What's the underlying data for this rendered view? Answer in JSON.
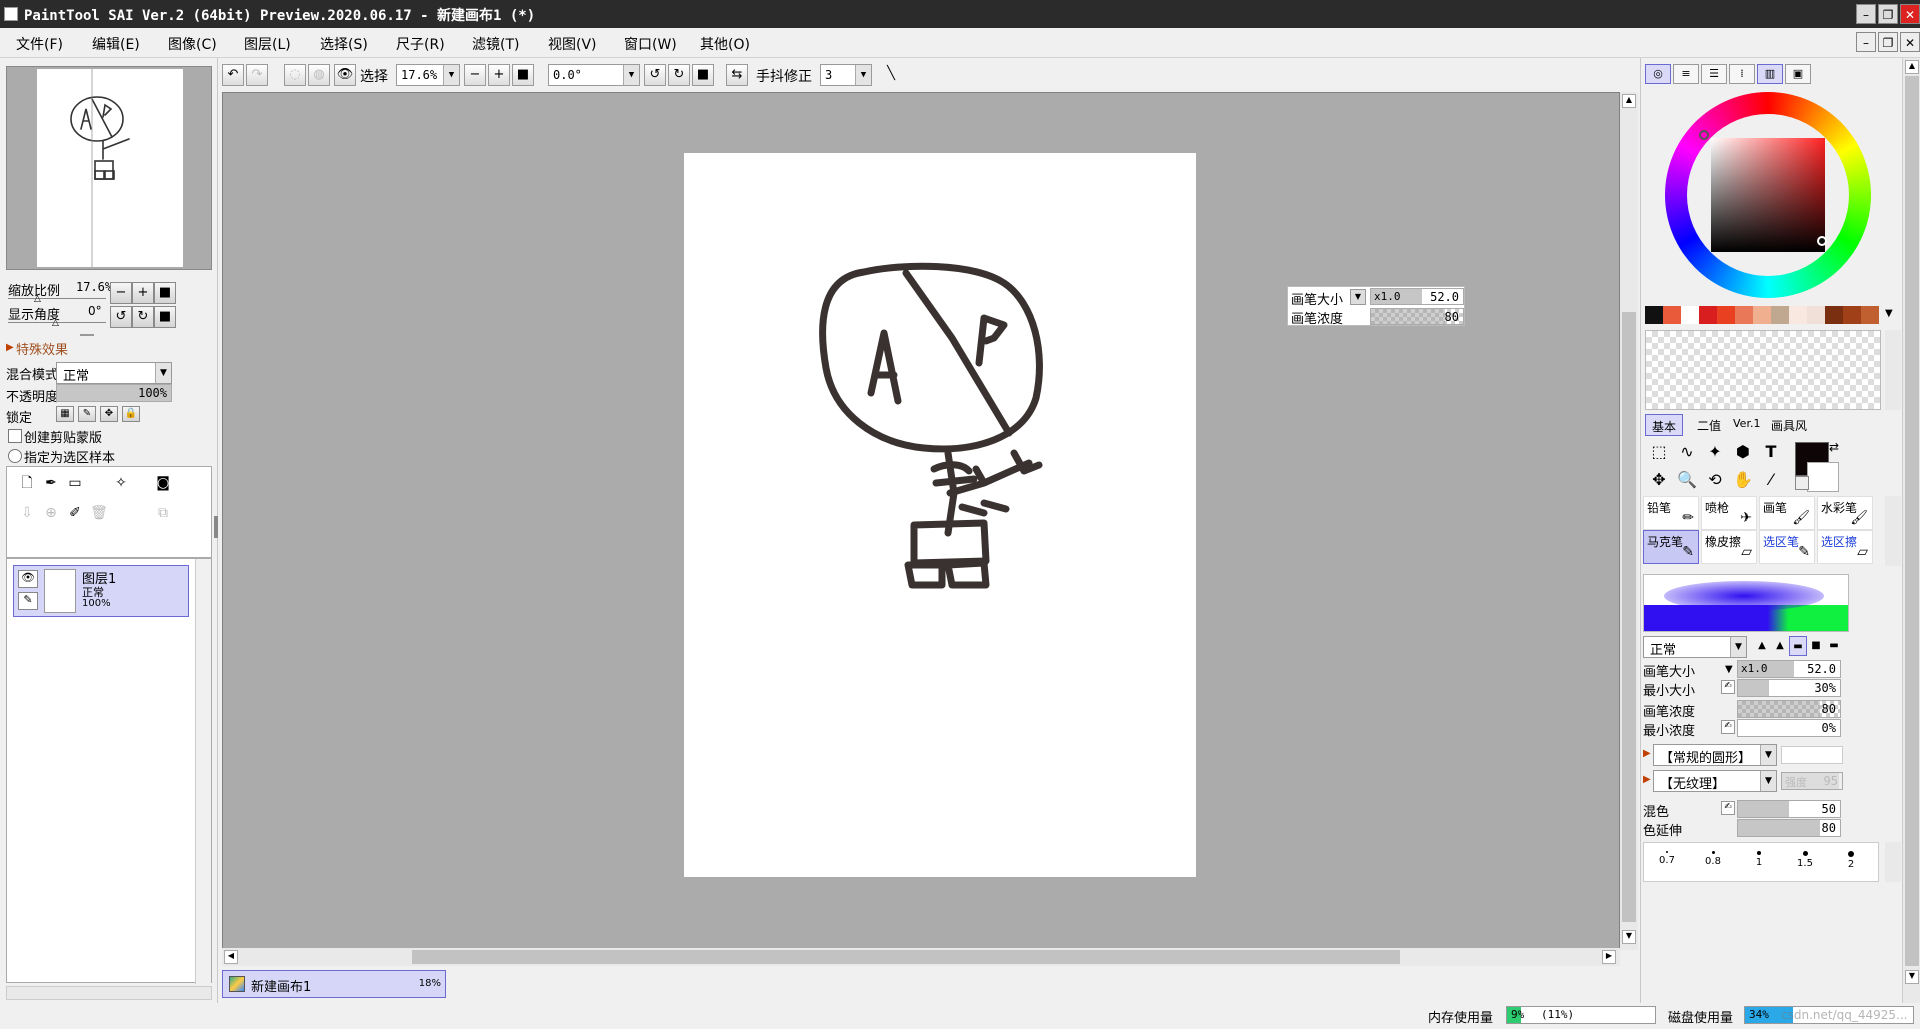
{
  "window": {
    "title": "PaintTool SAI Ver.2 (64bit) Preview.2020.06.17 - 新建画布1 (*)"
  },
  "menu": [
    "文件(F)",
    "编辑(E)",
    "图像(C)",
    "图层(L)",
    "选择(S)",
    "尺子(R)",
    "滤镜(T)",
    "视图(V)",
    "窗口(W)",
    "其他(O)"
  ],
  "toolbar": {
    "select_label": "选择",
    "zoom_value": "17.6%",
    "rotation_value": "0.0°",
    "stabilizer_label": "手抖修正",
    "stabilizer_value": "3"
  },
  "navigator": {
    "zoom_label": "缩放比例",
    "zoom_value": "17.6%",
    "angle_label": "显示角度",
    "angle_value": "0°"
  },
  "layer_props": {
    "effects_label": "特殊效果",
    "blend_label": "混合模式",
    "blend_value": "正常",
    "opacity_label": "不透明度",
    "opacity_value": "100%",
    "opacity_fraction": 1.0,
    "lock_label": "锁定",
    "clip_label": "创建剪贴蒙版",
    "selection_source_label": "指定为选区样本"
  },
  "layers": [
    {
      "name": "图层1",
      "mode": "正常",
      "opacity": "100%"
    }
  ],
  "brush_popup": {
    "size_label": "画笔大小",
    "size_mult": "x1.0",
    "size_value": "52.0",
    "density_label": "画笔浓度",
    "density_value": "80"
  },
  "document_tab": {
    "name": "新建画布1",
    "zoom": "18%"
  },
  "status": {
    "memory_label": "内存使用量",
    "memory_value": "9%",
    "memory_extra": "(11%)",
    "disk_label": "磁盘使用量",
    "disk_value": "34%",
    "watermark": "csdn.net/qq_44925..."
  },
  "color_swatches": [
    "#111111",
    "#e85a3a",
    "#ffffff",
    "#d81e1e",
    "#e84020",
    "#e87858",
    "#f0b090",
    "#c0a890",
    "#f8e8e0",
    "#f0e0d8",
    "#7a3010",
    "#a04018",
    "#c06030"
  ],
  "tool_tabs": [
    "基本",
    "二值",
    "Ver.1",
    "画具风"
  ],
  "brush_tools": [
    {
      "label": "铅笔",
      "icon": "pencil-icon"
    },
    {
      "label": "喷枪",
      "icon": "airbrush-icon"
    },
    {
      "label": "画笔",
      "icon": "brush-icon"
    },
    {
      "label": "水彩笔",
      "icon": "watercolor-icon"
    },
    {
      "label": "马克笔",
      "icon": "marker-icon"
    },
    {
      "label": "橡皮擦",
      "icon": "eraser-icon"
    },
    {
      "label": "选区笔",
      "icon": "selection-pen-icon"
    },
    {
      "label": "选区擦",
      "icon": "selection-eraser-icon"
    }
  ],
  "brush_settings": {
    "blend_mode": "正常",
    "size_label": "画笔大小",
    "size_mult": "x1.0",
    "size_value": "52.0",
    "min_size_label": "最小大小",
    "min_size_value": "30%",
    "min_size_fraction": 0.3,
    "density_label": "画笔浓度",
    "density_value": "80",
    "min_density_label": "最小浓度",
    "min_density_value": "0%",
    "shape_value": "【常规的圆形】",
    "texture_value": "【无纹理】",
    "texture_strength_label": "强度",
    "texture_strength_value": "95",
    "blend_label": "混色",
    "blend_value": "50",
    "blend_fraction": 0.5,
    "dilution_label": "色延伸",
    "dilution_value": "80",
    "dilution_fraction": 0.8,
    "size_presets": [
      "0.7",
      "0.8",
      "1",
      "1.5",
      "2"
    ]
  }
}
